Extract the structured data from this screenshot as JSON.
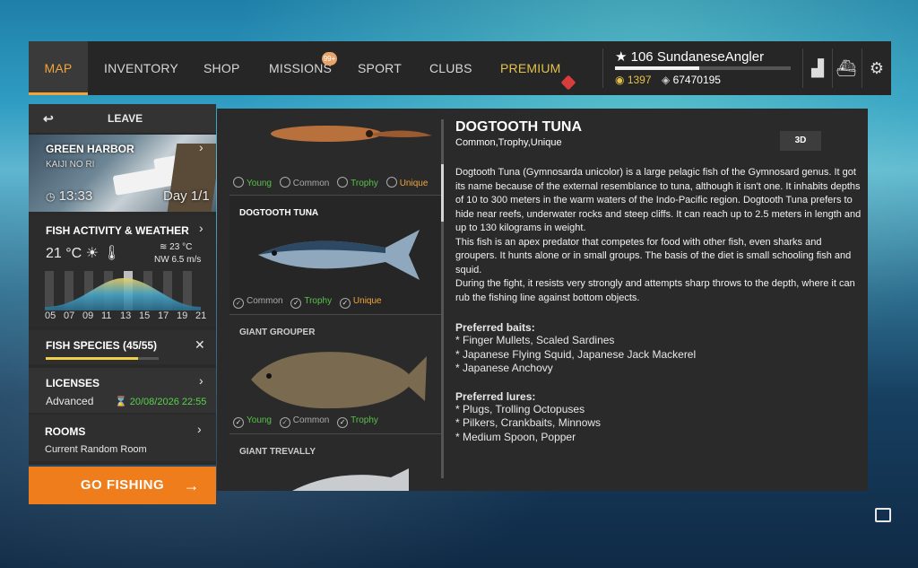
{
  "nav": {
    "tabs": [
      {
        "label": "MAP"
      },
      {
        "label": "INVENTORY"
      },
      {
        "label": "SHOP"
      },
      {
        "label": "MISSIONS",
        "badge": "99+"
      },
      {
        "label": "SPORT"
      },
      {
        "label": "CLUBS"
      },
      {
        "label": "PREMIUM"
      }
    ]
  },
  "player": {
    "level": "106",
    "name": "SundaneseAngler",
    "xp_progress": 0.48,
    "gold": "1397",
    "silver": "67470195"
  },
  "left": {
    "leave_label": "LEAVE",
    "location": "GREEN HARBOR",
    "sublocation": "KAIJI NO RI",
    "time": "13:33",
    "day": "Day 1/1",
    "activity_title": "FISH ACTIVITY & WEATHER",
    "air_temp": "21 °C",
    "water_temp": "23 °C",
    "wind": "NW 6.5 m/s",
    "hours": [
      "05",
      "07",
      "09",
      "11",
      "13",
      "15",
      "17",
      "19",
      "21"
    ],
    "species_title": "FISH SPECIES (45/55)",
    "species_progress": 0.82,
    "licenses_title": "LICENSES",
    "license_type": "Advanced",
    "license_date": "20/08/2026 22:55",
    "rooms_title": "ROOMS",
    "rooms_value": "Current Random Room",
    "go_fishing": "GO FISHING"
  },
  "fish_list": [
    {
      "name": "",
      "tags": [
        "Young",
        "Common",
        "Trophy",
        "Unique"
      ]
    },
    {
      "name": "DOGTOOTH TUNA",
      "tags": [
        "Common",
        "Trophy",
        "Unique"
      ]
    },
    {
      "name": "GIANT GROUPER",
      "tags": [
        "Young",
        "Common",
        "Trophy"
      ]
    },
    {
      "name": "GIANT TREVALLY",
      "tags": []
    }
  ],
  "detail": {
    "title": "DOGTOOTH TUNA",
    "subtitle": "Common,Trophy,Unique",
    "btn3d": "3D",
    "description": "Dogtooth Tuna (Gymnosarda unicolor) is a large pelagic fish of the Gymnosard genus. It got its name because of the external resemblance to tuna, although it isn't one. It inhabits depths of 10 to 300 meters in the warm waters of the Indo-Pacific region. Dogtooth Tuna prefers to hide near reefs, underwater rocks and steep cliffs. It can reach up to 2.5 meters in length and up to 130 kilograms in weight.\nThis fish is an apex predator that competes for food with other fish, even sharks and groupers. It hunts alone or in small groups. The basis of the diet is small schooling fish and squid.\nDuring the fight, it resists very strongly and attempts sharp throws to the depth, where it can rub the fishing line against bottom objects.",
    "baits_title": "Preferred baits:",
    "baits": [
      "* Finger Mullets, Scaled Sardines",
      "* Japanese Flying Squid, Japanese Jack Mackerel",
      "* Japanese Anchovy"
    ],
    "lures_title": "Preferred lures:",
    "lures": [
      "* Plugs, Trolling Octopuses",
      "* Pilkers, Crankbaits, Minnows",
      "* Medium Spoon, Popper"
    ]
  }
}
